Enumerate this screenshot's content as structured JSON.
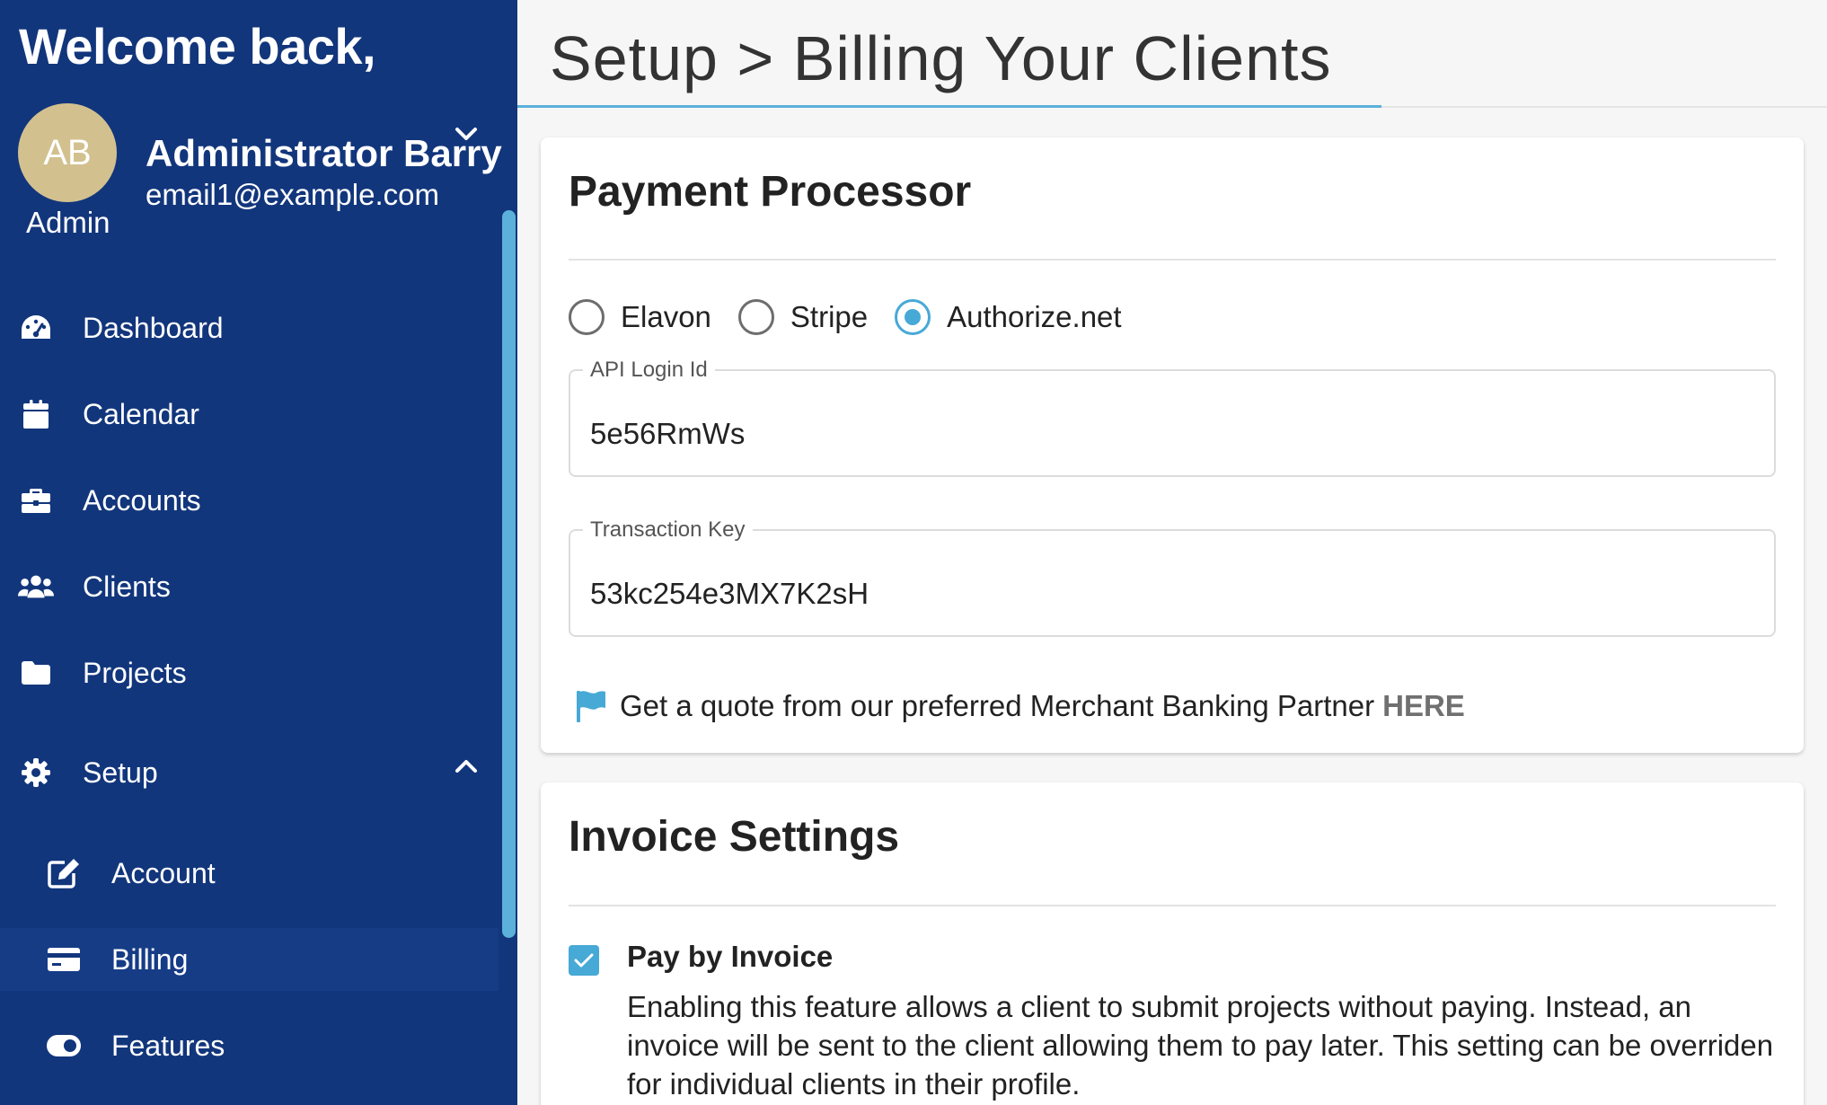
{
  "sidebar": {
    "welcome": "Welcome back,",
    "user": {
      "initials": "AB",
      "role": "Admin",
      "name": "Administrator Barry",
      "email": "email1@example.com"
    },
    "nav": {
      "dashboard": "Dashboard",
      "calendar": "Calendar",
      "accounts": "Accounts",
      "clients": "Clients",
      "projects": "Projects",
      "setup": "Setup",
      "account": "Account",
      "billing": "Billing",
      "features": "Features"
    }
  },
  "header": {
    "title": "Setup > Billing Your Clients"
  },
  "payment_processor": {
    "title": "Payment Processor",
    "options": {
      "elavon": "Elavon",
      "stripe": "Stripe",
      "authorize": "Authorize.net"
    },
    "selected": "Authorize.net",
    "api_login": {
      "label": "API Login Id",
      "value": "5e56RmWs"
    },
    "transaction_key": {
      "label": "Transaction Key",
      "value": "53kc254e3MX7K2sH"
    },
    "partner_text": "Get a quote from our preferred Merchant Banking Partner",
    "partner_link": "HERE"
  },
  "invoice_settings": {
    "title": "Invoice Settings",
    "pay_by_invoice": {
      "label": "Pay by Invoice",
      "checked": true,
      "description": "Enabling this feature allows a client to submit projects without paying. Instead, an invoice will be sent to the client allowing them to pay later. This setting can be overriden for individual clients in their profile."
    }
  },
  "colors": {
    "sidebar_bg": "#12367c",
    "accent": "#47a9d6",
    "avatar_bg": "#d2c18f"
  }
}
